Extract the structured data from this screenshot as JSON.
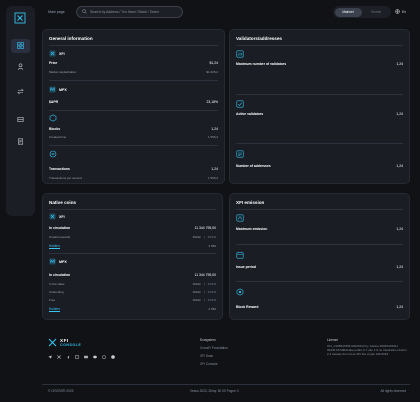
{
  "topbar": {
    "page_label": "Main page",
    "search_placeholder": "Search by Address / Txn Hash / Block / Token",
    "network_toggle": {
      "active": "Mainnet",
      "inactive": "Testnet"
    },
    "language": "En"
  },
  "sidebar": {
    "items": [
      {
        "icon": "dashboard-icon",
        "active": true
      },
      {
        "icon": "validators-icon",
        "active": false
      },
      {
        "icon": "transactions-icon",
        "active": false
      },
      {
        "icon": "blocks-icon",
        "active": false
      },
      {
        "icon": "contracts-icon",
        "active": false
      }
    ]
  },
  "general": {
    "title": "General information",
    "xfi": {
      "name": "XFI",
      "price_label": "Price",
      "price_value": "$1,24",
      "mcap_label": "Market capitalization",
      "mcap_value": "$1 625,2"
    },
    "mpx": {
      "name": "MPX",
      "apr_label": "$APR",
      "apr_value": "23,18%"
    },
    "blocks": {
      "label": "Blocks",
      "value": "1,24",
      "sub_label": "Created time",
      "sub_value": "1 555,2"
    },
    "transactions": {
      "label": "Transactions",
      "value": "1,24",
      "sub_label": "Transactions per second",
      "sub_value": "1 555,2"
    }
  },
  "validators": {
    "title": "Validators/addresses",
    "items": [
      {
        "label": "Maximum number of validators",
        "value": "1,24"
      },
      {
        "label": "Active validators",
        "value": "1,24"
      },
      {
        "label": "Number of addresses",
        "value": "1,24"
      }
    ]
  },
  "native": {
    "title": "Native coins",
    "xfi": {
      "name": "XFI",
      "circ_label": "In circulation",
      "circ_value": "11 344 795,00",
      "rows": [
        {
          "label": "Unpaid rewards",
          "value": "15232",
          "pct": "15.6%"
        }
      ],
      "holders_label": "Holders",
      "holders_value": "2 550"
    },
    "mpx": {
      "name": "MPX",
      "circ_label": "In circulation",
      "circ_value": "11 344 795,00",
      "rows": [
        {
          "label": "In the stake",
          "value": "15232",
          "pct": "15.6%"
        },
        {
          "label": "Unbonding",
          "value": "15232",
          "pct": "15.6%"
        },
        {
          "label": "Free",
          "value": "15232",
          "pct": "15.6%"
        }
      ],
      "holders_label": "Holders",
      "holders_value": "2 550"
    }
  },
  "emission": {
    "title": "XFI emission",
    "items": [
      {
        "label": "Maximum emission",
        "value": "1,24"
      },
      {
        "label": "Issue period",
        "value": "1,24"
      },
      {
        "label": "Block Reward",
        "value": "1,24"
      }
    ]
  },
  "footer": {
    "logo_line1": "XFI",
    "logo_line2": "CONSOLE",
    "social_icons": [
      "telegram-icon",
      "twitter-icon",
      "facebook-icon",
      "linkedin-icon",
      "youtube-icon",
      "discord-icon",
      "reddit-icon",
      "github-icon"
    ],
    "links_title": "Ecosystem",
    "links": [
      "CrossFi Foundation",
      "XFI Scan",
      "XFI Console"
    ],
    "license_title": "License",
    "license_text": "XFI_v.008547896 00025412 by Justice 00025478421 00245 69 Milkshake public 0.7 site 1.0 no translation ubuntu 2.4 release from here XFI the crypto 011/2023",
    "copyright": "© CROSSFI 2023",
    "version": "Vesus 2023, Zhiuy. 50 00 Pogue 3",
    "rights": "All rights reserved"
  },
  "colors": {
    "accent": "#37c4f0",
    "background": "#101216",
    "card": "#1a1d24"
  }
}
